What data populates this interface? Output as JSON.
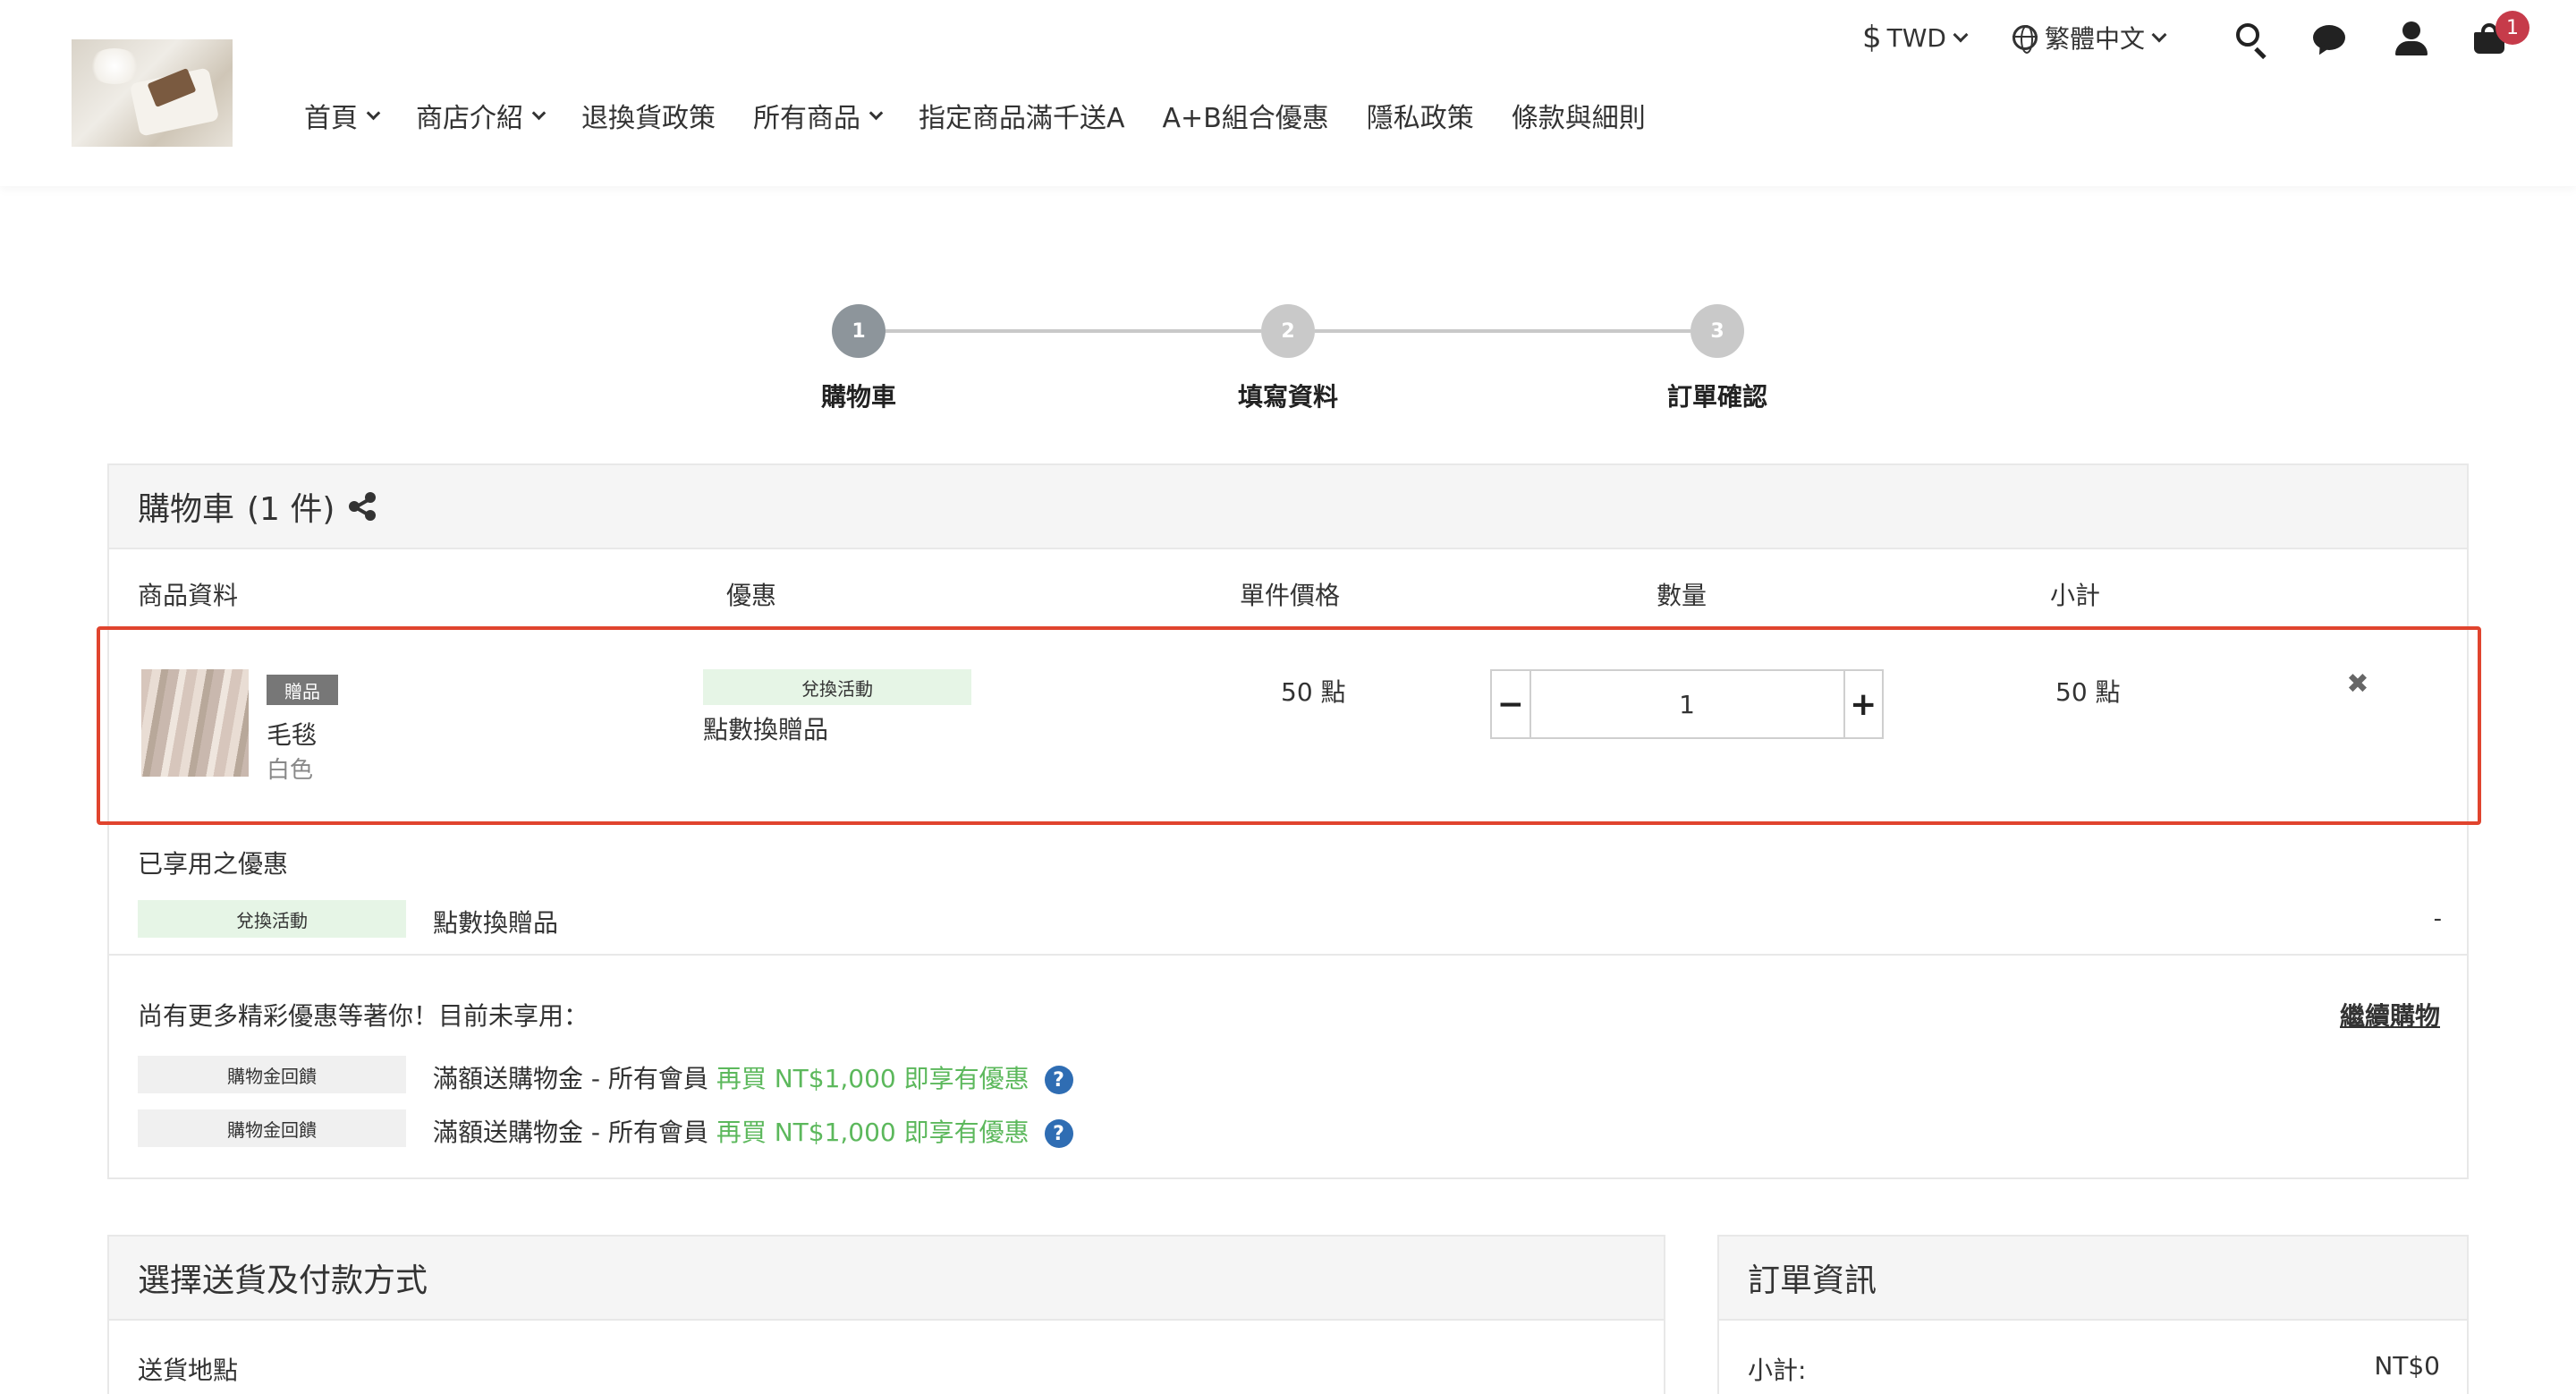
{
  "header": {
    "currency": "TWD",
    "language": "繁體中文",
    "cart_count": "1",
    "nav": [
      "首頁",
      "商店介紹",
      "退換貨政策",
      "所有商品",
      "指定商品滿千送A",
      "A+B組合優惠",
      "隱私政策",
      "條款與細則"
    ],
    "nav_dropdown": [
      true,
      true,
      false,
      true,
      false,
      false,
      false,
      false
    ]
  },
  "stepper": {
    "steps": [
      {
        "num": "1",
        "label": "購物車"
      },
      {
        "num": "2",
        "label": "填寫資料"
      },
      {
        "num": "3",
        "label": "訂單確認"
      }
    ],
    "active": 1
  },
  "cart": {
    "title": "購物車",
    "count_text": "(1 件)",
    "columns": {
      "product": "商品資料",
      "promo": "優惠",
      "unit_price": "單件價格",
      "quantity": "數量",
      "subtotal": "小計"
    },
    "item": {
      "badge": "贈品",
      "name": "毛毯",
      "variant": "白色",
      "promo_tag": "兌換活動",
      "promo_name": "點數換贈品",
      "unit_price": "50 點",
      "quantity": "1",
      "subtotal": "50 點"
    },
    "applied": {
      "title": "已享用之優惠",
      "tag": "兌換活動",
      "name": "點數換贈品",
      "value": "-"
    },
    "more": {
      "title": "尚有更多精彩優惠等著你！目前未享用：",
      "continue_label": "繼續購物",
      "offers": [
        {
          "tag": "購物金回饋",
          "text": "滿額送購物金 - 所有會員",
          "highlight": "再買 NT$1,000 即享有優惠"
        },
        {
          "tag": "購物金回饋",
          "text": "滿額送購物金 - 所有會員",
          "highlight": "再買 NT$1,000 即享有優惠"
        }
      ]
    }
  },
  "shipping": {
    "title": "選擇送貨及付款方式",
    "field_label": "送貨地點"
  },
  "order": {
    "title": "訂單資訊",
    "subtotal_label": "小計:",
    "subtotal_value": "NT$0"
  },
  "colors": {
    "accent_red": "#e0442e",
    "badge_red": "#c63b4a",
    "promo_green_bg": "#e6f5e6",
    "highlight_green": "#5cb85c",
    "help_blue": "#2f6db3"
  }
}
